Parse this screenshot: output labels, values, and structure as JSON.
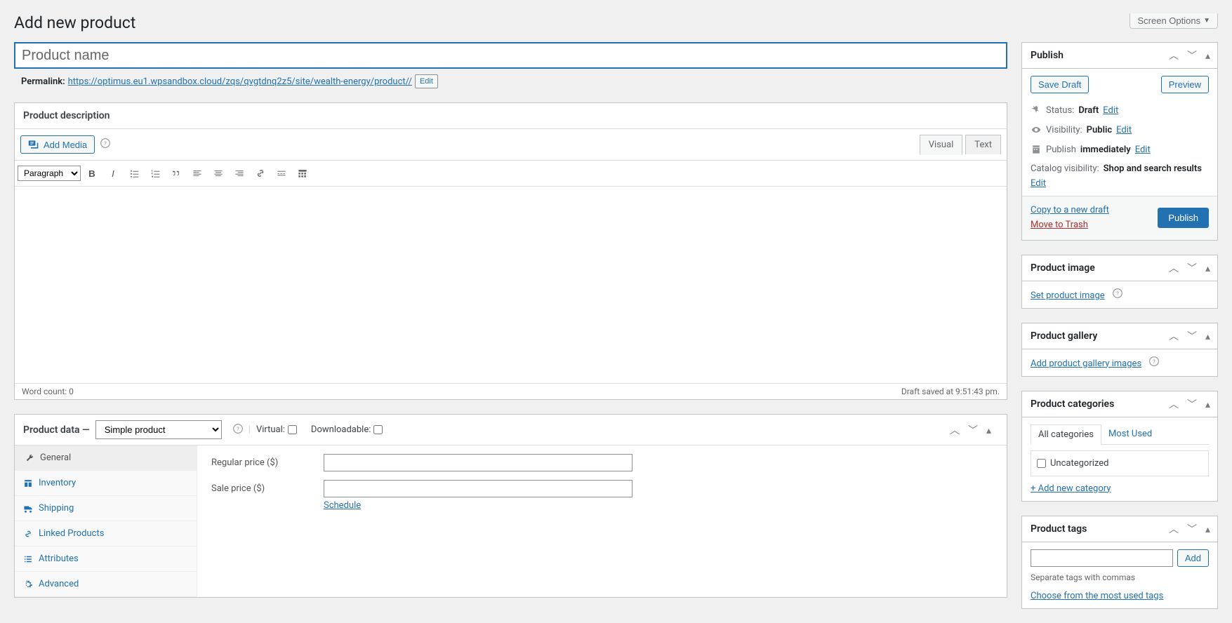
{
  "page_title": "Add new product",
  "screen_options": "Screen Options",
  "title_placeholder": "Product name",
  "permalink": {
    "label": "Permalink:",
    "url": "https://optimus.eu1.wpsandbox.cloud/zqs/qvgtdnq2z5/site/wealth-energy/product//",
    "edit": "Edit"
  },
  "description": {
    "heading": "Product description",
    "add_media": "Add Media",
    "tab_visual": "Visual",
    "tab_text": "Text",
    "format_select": "Paragraph",
    "word_count": "Word count: 0",
    "draft_saved": "Draft saved at 9:51:43 pm."
  },
  "product_data": {
    "heading": "Product data —",
    "type": "Simple product",
    "virtual": "Virtual:",
    "downloadable": "Downloadable:",
    "tabs": {
      "general": "General",
      "inventory": "Inventory",
      "shipping": "Shipping",
      "linked": "Linked Products",
      "attributes": "Attributes",
      "advanced": "Advanced"
    },
    "fields": {
      "regular_price": "Regular price ($)",
      "sale_price": "Sale price ($)",
      "schedule": "Schedule"
    }
  },
  "publish": {
    "heading": "Publish",
    "save_draft": "Save Draft",
    "preview": "Preview",
    "status_label": "Status:",
    "status_value": "Draft",
    "visibility_label": "Visibility:",
    "visibility_value": "Public",
    "publish_label": "Publish",
    "publish_value": "immediately",
    "catalog_label": "Catalog visibility:",
    "catalog_value": "Shop and search results",
    "edit": "Edit",
    "copy_draft": "Copy to a new draft",
    "move_trash": "Move to Trash",
    "publish_btn": "Publish"
  },
  "product_image": {
    "heading": "Product image",
    "link": "Set product image"
  },
  "product_gallery": {
    "heading": "Product gallery",
    "link": "Add product gallery images"
  },
  "categories": {
    "heading": "Product categories",
    "tab_all": "All categories",
    "tab_most": "Most Used",
    "item_uncat": "Uncategorized",
    "add_new": "+ Add new category"
  },
  "tags": {
    "heading": "Product tags",
    "add_btn": "Add",
    "hint": "Separate tags with commas",
    "choose": "Choose from the most used tags"
  }
}
